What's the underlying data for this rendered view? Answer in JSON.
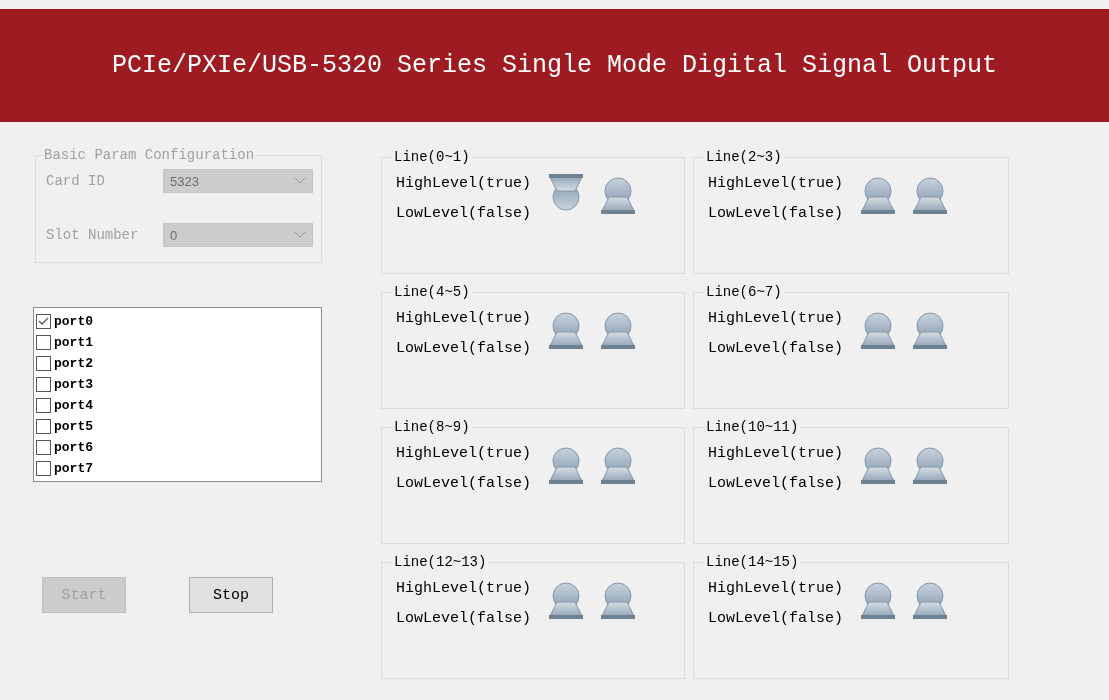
{
  "window": {
    "title": "PCIe/PXIe/USB-5320 Series Single Mode Digital Signal Output"
  },
  "basic_params": {
    "title": "Basic Param Configuration",
    "disabled": true,
    "fields": [
      {
        "label": "Card ID",
        "value": "5323"
      },
      {
        "label": "Slot Number",
        "value": "0"
      }
    ]
  },
  "ports": [
    {
      "label": "port0",
      "checked": true
    },
    {
      "label": "port1",
      "checked": false
    },
    {
      "label": "port2",
      "checked": false
    },
    {
      "label": "port3",
      "checked": false
    },
    {
      "label": "port4",
      "checked": false
    },
    {
      "label": "port5",
      "checked": false
    },
    {
      "label": "port6",
      "checked": false
    },
    {
      "label": "port7",
      "checked": false
    }
  ],
  "buttons": [
    {
      "label": "Start",
      "disabled": true
    },
    {
      "label": "Stop",
      "disabled": false
    }
  ],
  "lines": [
    {
      "title": "Line(0~1)",
      "high_label": "HighLevel(true)",
      "low_label": "LowLevel(false)",
      "switches": [
        {
          "on": true
        },
        {
          "on": false
        }
      ]
    },
    {
      "title": "Line(2~3)",
      "high_label": "HighLevel(true)",
      "low_label": "LowLevel(false)",
      "switches": [
        {
          "on": false
        },
        {
          "on": false
        }
      ]
    },
    {
      "title": "Line(4~5)",
      "high_label": "HighLevel(true)",
      "low_label": "LowLevel(false)",
      "switches": [
        {
          "on": false
        },
        {
          "on": false
        }
      ]
    },
    {
      "title": "Line(6~7)",
      "high_label": "HighLevel(true)",
      "low_label": "LowLevel(false)",
      "switches": [
        {
          "on": false
        },
        {
          "on": false
        }
      ]
    },
    {
      "title": "Line(8~9)",
      "high_label": "HighLevel(true)",
      "low_label": "LowLevel(false)",
      "switches": [
        {
          "on": false
        },
        {
          "on": false
        }
      ]
    },
    {
      "title": "Line(10~11)",
      "high_label": "HighLevel(true)",
      "low_label": "LowLevel(false)",
      "switches": [
        {
          "on": false
        },
        {
          "on": false
        }
      ]
    },
    {
      "title": "Line(12~13)",
      "high_label": "HighLevel(true)",
      "low_label": "LowLevel(false)",
      "switches": [
        {
          "on": false
        },
        {
          "on": false
        }
      ]
    },
    {
      "title": "Line(14~15)",
      "high_label": "HighLevel(true)",
      "low_label": "LowLevel(false)",
      "switches": [
        {
          "on": false
        },
        {
          "on": false
        }
      ]
    }
  ]
}
